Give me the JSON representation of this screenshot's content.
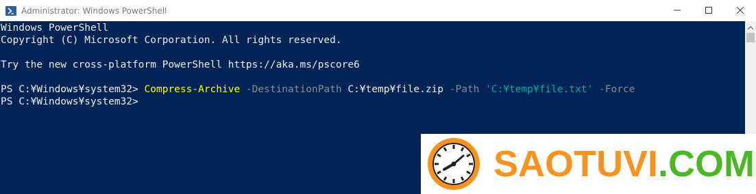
{
  "window": {
    "title": "Administrator: Windows PowerShell",
    "icons": {
      "app": "powershell-icon",
      "minimize": "minimize-icon",
      "maximize": "maximize-icon",
      "close": "close-icon"
    }
  },
  "console": {
    "line1": "Windows PowerShell",
    "line2": "Copyright (C) Microsoft Corporation. All rights reserved.",
    "line3": "Try the new cross-platform PowerShell https://aka.ms/pscore6",
    "cmd_line": {
      "prompt": "PS C:¥Windows¥system32> ",
      "cmdlet": "Compress-Archive",
      "param1": " -DestinationPath",
      "value1": " C:¥temp¥file.zip",
      "param2": " -Path",
      "string_arg": " 'C:¥temp¥file.txt'",
      "param3": " -Force"
    },
    "prompt_line": "PS C:¥Windows¥system32>",
    "colors": {
      "background": "#012456",
      "text": "#eeedf0",
      "cmdlet": "#ffff00",
      "parameter": "#8c8c8c",
      "string": "#00aaaa"
    }
  },
  "watermark": {
    "part1": "SAOTUVI",
    "part2": ".COM",
    "logo": "clock-icon",
    "colors": {
      "orange": "#f7931e",
      "green": "#49b823"
    }
  }
}
